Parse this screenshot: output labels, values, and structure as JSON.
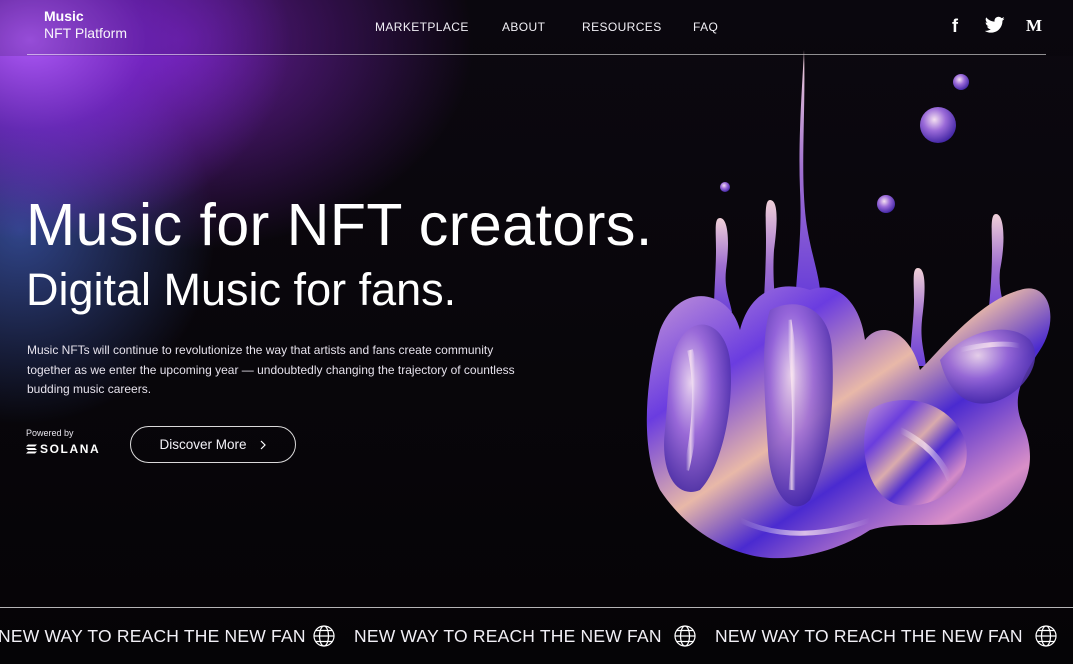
{
  "brand": {
    "line1": "Music",
    "line2": "NFT Platform"
  },
  "nav": {
    "items": [
      {
        "label": "MARKETPLACE"
      },
      {
        "label": "ABOUT"
      },
      {
        "label": "RESOURCES"
      },
      {
        "label": "FAQ"
      }
    ]
  },
  "social": {
    "facebook_glyph": "f",
    "medium_glyph": "M",
    "icons": [
      "facebook-icon",
      "twitter-icon",
      "medium-icon"
    ]
  },
  "hero": {
    "headline": "Music for NFT creators.",
    "subheadline": "Digital Music for fans.",
    "description": "Music NFTs will continue to revolutionize the way that artists and fans create community together as we enter the upcoming year — undoubtedly changing the trajectory of countless budding music careers.",
    "powered_by": "Powered by",
    "powered_brand": "SOLANA",
    "cta_label": "Discover More"
  },
  "ticker": {
    "text": "NEW WAY TO REACH THE NEW FAN",
    "icon": "globe-icon"
  },
  "colors": {
    "accent_purple": "#9a3cf0",
    "accent_blue": "#5a78f0",
    "background": "#070608",
    "text": "#ffffff"
  }
}
